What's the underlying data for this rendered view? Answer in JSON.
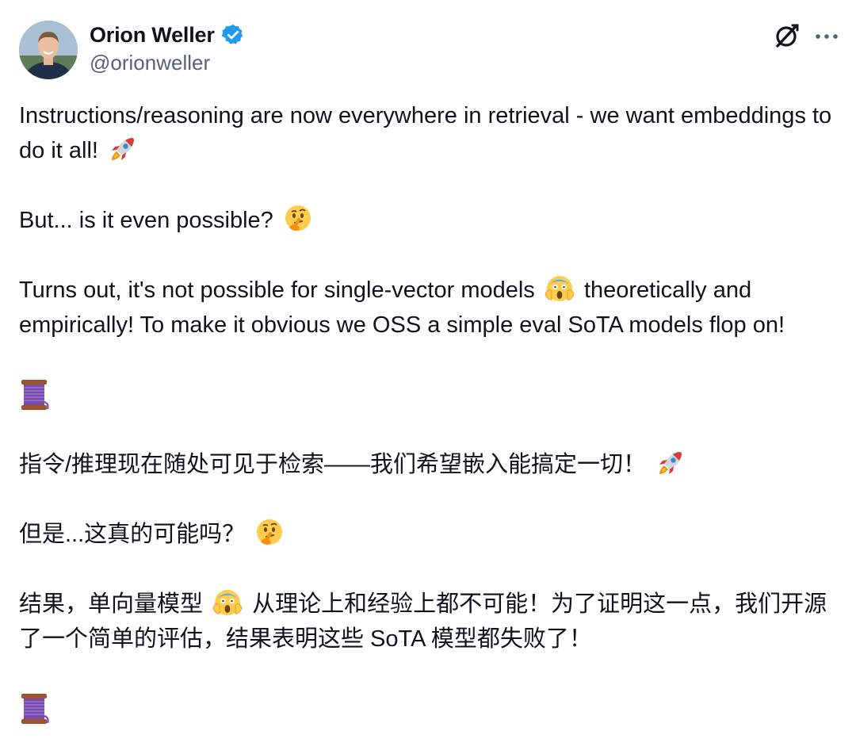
{
  "author": {
    "display_name": "Orion Weller",
    "handle": "@orionweller",
    "verified": true
  },
  "colors": {
    "verified": "#1d9bf0",
    "text": "#0f1419",
    "muted": "#536471"
  },
  "icons": {
    "header_right": [
      "grok-icon",
      "more-icon"
    ],
    "rocket": "rocket-icon",
    "thinking": "thinking-face-icon",
    "scream": "screaming-face-icon",
    "thread": "thread-spool-icon"
  },
  "post": {
    "p1_text": "Instructions/reasoning are now everywhere in retrieval - we want embeddings to do it all!",
    "p2_text": "But... is it even possible?",
    "p3_before": "Turns out, it's not possible for single-vector models",
    "p3_after": "theoretically and empirically! To make it obvious we OSS a simple eval SoTA models flop on!",
    "zh1_text": "指令/推理现在随处可见于检索——我们希望嵌入能搞定一切！",
    "zh2_text": "但是...这真的可能吗？",
    "zh3_before": "结果，单向量模型",
    "zh3_after": "从理论上和经验上都不可能！为了证明这一点，我们开源了一个简单的评估，结果表明这些 SoTA 模型都失败了！"
  }
}
